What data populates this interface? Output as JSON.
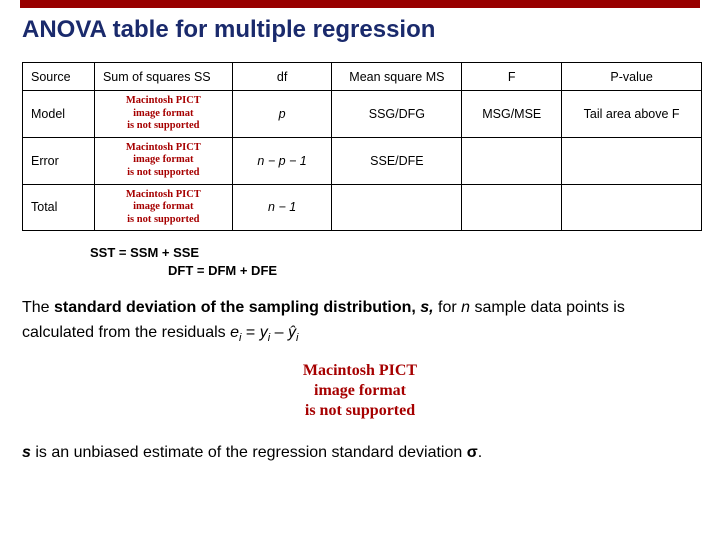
{
  "title": "ANOVA table for multiple regression",
  "pict": {
    "l1": "Macintosh PICT",
    "l2": "image format",
    "l3": "is not supported"
  },
  "headers": [
    "Source",
    "Sum of squares SS",
    "df",
    "Mean square MS",
    "F",
    "P-value"
  ],
  "rows": {
    "model": {
      "src": "Model",
      "df": "p",
      "ms": "SSG/DFG",
      "f": "MSG/MSE",
      "p": "Tail area above F"
    },
    "error": {
      "src": "Error",
      "df": "n − p − 1",
      "ms": "SSE/DFE"
    },
    "total": {
      "src": "Total",
      "df": "n − 1"
    }
  },
  "eq": {
    "a": "SST = SSM + SSE",
    "b": "DFT = DFM + DFE"
  },
  "text1": {
    "a": "The ",
    "b": "standard deviation of the sampling distribution, ",
    "c": "s,",
    "d": " for ",
    "e": "n",
    "f": " sample data points is calculated from the residuals ",
    "g": "e",
    "h": "i",
    "i": " = ",
    "j": "y",
    "k": "i",
    "l": " – ",
    "m": "ŷ",
    "n": "i"
  },
  "text2": {
    "a": "s",
    "b": " is an unbiased estimate of the regression standard deviation ",
    "c": "σ",
    "d": "."
  }
}
